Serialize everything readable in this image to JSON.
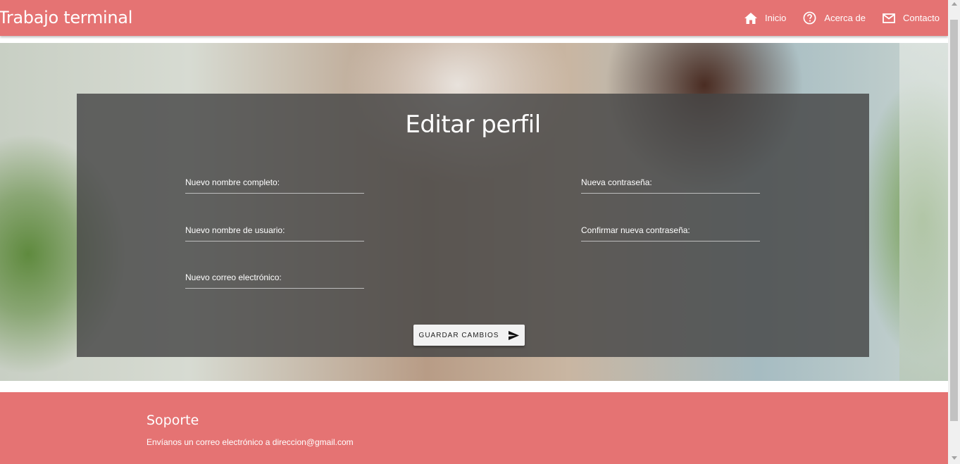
{
  "navbar": {
    "brand": "Trabajo terminal",
    "links": [
      {
        "label": "Inicio",
        "icon": "home-icon"
      },
      {
        "label": "Acerca de",
        "icon": "help-circle-icon"
      },
      {
        "label": "Contacto",
        "icon": "mail-icon"
      }
    ]
  },
  "form": {
    "title": "Editar perfil",
    "fields": {
      "full_name": {
        "label": "Nuevo nombre completo:",
        "value": ""
      },
      "username": {
        "label": "Nuevo nombre de usuario:",
        "value": ""
      },
      "email": {
        "label": "Nuevo correo electrónico:",
        "value": ""
      },
      "password": {
        "label": "Nueva contraseña:",
        "value": ""
      },
      "confirm_password": {
        "label": "Confirmar nueva contraseña:",
        "value": ""
      }
    },
    "save_label": "GUARDAR CAMBIOS",
    "save_icon": "send-icon"
  },
  "footer": {
    "title": "Soporte",
    "text": "Envíanos un correo electrónico a direccion@gmail.com"
  },
  "colors": {
    "brand": "#e57373",
    "panel": "#464646"
  }
}
